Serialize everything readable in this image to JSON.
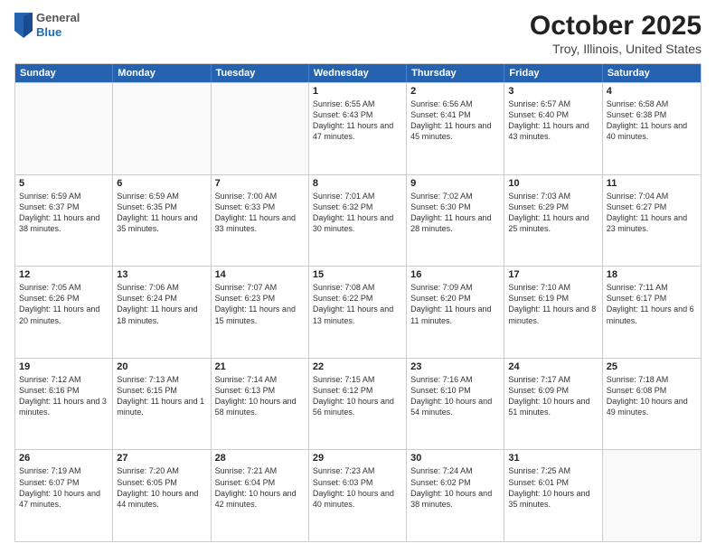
{
  "logo": {
    "general": "General",
    "blue": "Blue"
  },
  "header": {
    "title": "October 2025",
    "subtitle": "Troy, Illinois, United States"
  },
  "days_of_week": [
    "Sunday",
    "Monday",
    "Tuesday",
    "Wednesday",
    "Thursday",
    "Friday",
    "Saturday"
  ],
  "weeks": [
    [
      {
        "day": "",
        "empty": true
      },
      {
        "day": "",
        "empty": true
      },
      {
        "day": "",
        "empty": true
      },
      {
        "day": "1",
        "sunrise": "6:55 AM",
        "sunset": "6:43 PM",
        "daylight": "11 hours and 47 minutes."
      },
      {
        "day": "2",
        "sunrise": "6:56 AM",
        "sunset": "6:41 PM",
        "daylight": "11 hours and 45 minutes."
      },
      {
        "day": "3",
        "sunrise": "6:57 AM",
        "sunset": "6:40 PM",
        "daylight": "11 hours and 43 minutes."
      },
      {
        "day": "4",
        "sunrise": "6:58 AM",
        "sunset": "6:38 PM",
        "daylight": "11 hours and 40 minutes."
      }
    ],
    [
      {
        "day": "5",
        "sunrise": "6:59 AM",
        "sunset": "6:37 PM",
        "daylight": "11 hours and 38 minutes."
      },
      {
        "day": "6",
        "sunrise": "6:59 AM",
        "sunset": "6:35 PM",
        "daylight": "11 hours and 35 minutes."
      },
      {
        "day": "7",
        "sunrise": "7:00 AM",
        "sunset": "6:33 PM",
        "daylight": "11 hours and 33 minutes."
      },
      {
        "day": "8",
        "sunrise": "7:01 AM",
        "sunset": "6:32 PM",
        "daylight": "11 hours and 30 minutes."
      },
      {
        "day": "9",
        "sunrise": "7:02 AM",
        "sunset": "6:30 PM",
        "daylight": "11 hours and 28 minutes."
      },
      {
        "day": "10",
        "sunrise": "7:03 AM",
        "sunset": "6:29 PM",
        "daylight": "11 hours and 25 minutes."
      },
      {
        "day": "11",
        "sunrise": "7:04 AM",
        "sunset": "6:27 PM",
        "daylight": "11 hours and 23 minutes."
      }
    ],
    [
      {
        "day": "12",
        "sunrise": "7:05 AM",
        "sunset": "6:26 PM",
        "daylight": "11 hours and 20 minutes."
      },
      {
        "day": "13",
        "sunrise": "7:06 AM",
        "sunset": "6:24 PM",
        "daylight": "11 hours and 18 minutes."
      },
      {
        "day": "14",
        "sunrise": "7:07 AM",
        "sunset": "6:23 PM",
        "daylight": "11 hours and 15 minutes."
      },
      {
        "day": "15",
        "sunrise": "7:08 AM",
        "sunset": "6:22 PM",
        "daylight": "11 hours and 13 minutes."
      },
      {
        "day": "16",
        "sunrise": "7:09 AM",
        "sunset": "6:20 PM",
        "daylight": "11 hours and 11 minutes."
      },
      {
        "day": "17",
        "sunrise": "7:10 AM",
        "sunset": "6:19 PM",
        "daylight": "11 hours and 8 minutes."
      },
      {
        "day": "18",
        "sunrise": "7:11 AM",
        "sunset": "6:17 PM",
        "daylight": "11 hours and 6 minutes."
      }
    ],
    [
      {
        "day": "19",
        "sunrise": "7:12 AM",
        "sunset": "6:16 PM",
        "daylight": "11 hours and 3 minutes."
      },
      {
        "day": "20",
        "sunrise": "7:13 AM",
        "sunset": "6:15 PM",
        "daylight": "11 hours and 1 minute."
      },
      {
        "day": "21",
        "sunrise": "7:14 AM",
        "sunset": "6:13 PM",
        "daylight": "10 hours and 58 minutes."
      },
      {
        "day": "22",
        "sunrise": "7:15 AM",
        "sunset": "6:12 PM",
        "daylight": "10 hours and 56 minutes."
      },
      {
        "day": "23",
        "sunrise": "7:16 AM",
        "sunset": "6:10 PM",
        "daylight": "10 hours and 54 minutes."
      },
      {
        "day": "24",
        "sunrise": "7:17 AM",
        "sunset": "6:09 PM",
        "daylight": "10 hours and 51 minutes."
      },
      {
        "day": "25",
        "sunrise": "7:18 AM",
        "sunset": "6:08 PM",
        "daylight": "10 hours and 49 minutes."
      }
    ],
    [
      {
        "day": "26",
        "sunrise": "7:19 AM",
        "sunset": "6:07 PM",
        "daylight": "10 hours and 47 minutes."
      },
      {
        "day": "27",
        "sunrise": "7:20 AM",
        "sunset": "6:05 PM",
        "daylight": "10 hours and 44 minutes."
      },
      {
        "day": "28",
        "sunrise": "7:21 AM",
        "sunset": "6:04 PM",
        "daylight": "10 hours and 42 minutes."
      },
      {
        "day": "29",
        "sunrise": "7:23 AM",
        "sunset": "6:03 PM",
        "daylight": "10 hours and 40 minutes."
      },
      {
        "day": "30",
        "sunrise": "7:24 AM",
        "sunset": "6:02 PM",
        "daylight": "10 hours and 38 minutes."
      },
      {
        "day": "31",
        "sunrise": "7:25 AM",
        "sunset": "6:01 PM",
        "daylight": "10 hours and 35 minutes."
      },
      {
        "day": "",
        "empty": true
      }
    ]
  ]
}
